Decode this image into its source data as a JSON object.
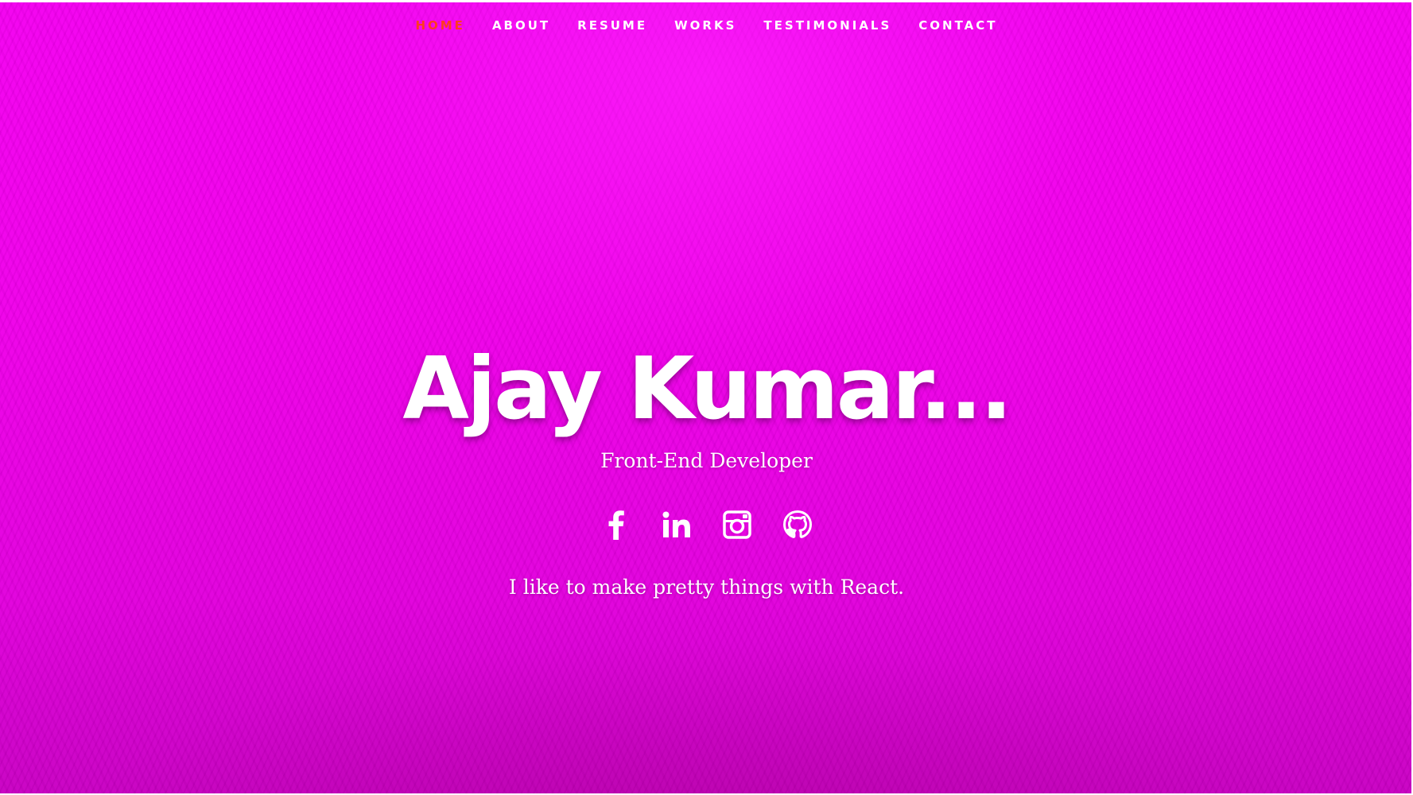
{
  "nav": {
    "items": [
      {
        "label": "HOME",
        "active": true
      },
      {
        "label": "ABOUT",
        "active": false
      },
      {
        "label": "RESUME",
        "active": false
      },
      {
        "label": "WORKS",
        "active": false
      },
      {
        "label": "TESTIMONIALS",
        "active": false
      },
      {
        "label": "CONTACT",
        "active": false
      }
    ],
    "active_color": "#ff3b1f"
  },
  "banner": {
    "name": "Ajay Kumar...",
    "role": "Front-End Developer",
    "tagline": "I like to make pretty things with React."
  },
  "social": [
    {
      "icon": "facebook-icon"
    },
    {
      "icon": "linkedin-icon"
    },
    {
      "icon": "instagram-icon"
    },
    {
      "icon": "github-icon"
    }
  ],
  "colors": {
    "background": "#ee00e8",
    "text": "#ffffff"
  }
}
